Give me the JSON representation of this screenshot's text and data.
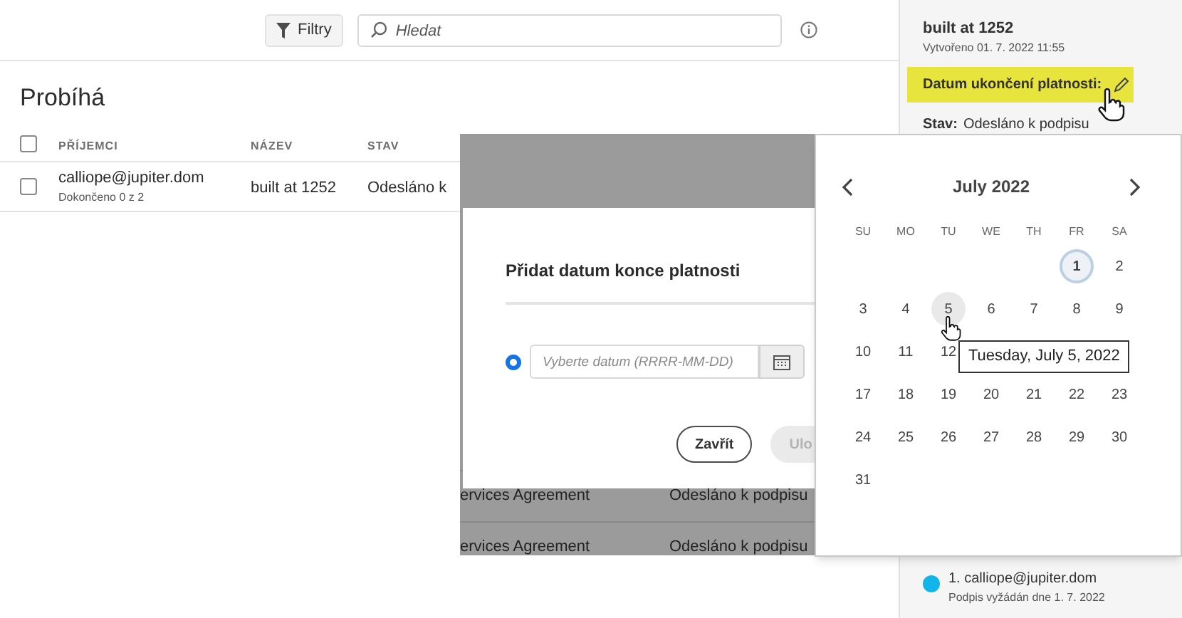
{
  "toolbar": {
    "filter_button": "Filtry",
    "search": {
      "placeholder": "Hledat"
    }
  },
  "section_title": "Probíhá",
  "table": {
    "header_checked": false,
    "columns": [
      "PŘÍJEMCI",
      "NÁZEV",
      "STAV"
    ],
    "rows": [
      {
        "checked": false,
        "recipient": "calliope@jupiter.dom",
        "progress": "Dokončeno 0 z 2",
        "name": "built at 1252",
        "status": "Odesláno k"
      }
    ]
  },
  "background_rows": [
    {
      "name": "ervices Agreement",
      "status": "Odesláno k podpisu"
    },
    {
      "name": "ervices Agreement",
      "status": "Odesláno k podpisu"
    }
  ],
  "details": {
    "title": "built at 1252",
    "created": "Vytvořeno 01. 7. 2022 11:55",
    "expiry_label": "Datum ukončení platnosti:",
    "status_label": "Stav:",
    "status": "Odesláno k podpisu",
    "signers": [
      {
        "label": "1. calliope@jupiter.dom",
        "note": "Podpis vyžádán dne 1. 7. 2022",
        "color": "#12b5ea"
      }
    ]
  },
  "dialog": {
    "title": "Přidat datum konce platnosti",
    "radio": {
      "selected": true
    },
    "date_field": {
      "placeholder": "Vyberte datum (RRRR-MM-DD)"
    },
    "buttons": [
      {
        "label": "Zavřít",
        "disabled": false
      },
      {
        "label": "Ulo",
        "disabled": true
      }
    ]
  },
  "calendar": {
    "month": "July 2022",
    "weekdays": [
      "SU",
      "MO",
      "TU",
      "WE",
      "TH",
      "FR",
      "SA"
    ],
    "weeks": [
      [
        {
          "kind": "blank"
        },
        {
          "kind": "blank"
        },
        {
          "kind": "blank"
        },
        {
          "kind": "blank"
        },
        {
          "kind": "blank"
        },
        {
          "kind": "day",
          "day": "1",
          "today": true,
          "hovered": false
        },
        {
          "kind": "day",
          "day": "2",
          "today": false,
          "hovered": false
        }
      ],
      [
        {
          "kind": "day",
          "day": "3",
          "today": false,
          "hovered": false
        },
        {
          "kind": "day",
          "day": "4",
          "today": false,
          "hovered": false
        },
        {
          "kind": "day",
          "day": "5",
          "today": false,
          "hovered": true
        },
        {
          "kind": "day",
          "day": "6",
          "today": false,
          "hovered": false
        },
        {
          "kind": "day",
          "day": "7",
          "today": false,
          "hovered": false
        },
        {
          "kind": "day",
          "day": "8",
          "today": false,
          "hovered": false
        },
        {
          "kind": "day",
          "day": "9",
          "today": false,
          "hovered": false
        }
      ],
      [
        {
          "kind": "day",
          "day": "10",
          "today": false,
          "hovered": false
        },
        {
          "kind": "day",
          "day": "11",
          "today": false,
          "hovered": false
        },
        {
          "kind": "day",
          "day": "12",
          "today": false,
          "hovered": false
        },
        {
          "kind": "blank"
        },
        {
          "kind": "blank"
        },
        {
          "kind": "blank"
        },
        {
          "kind": "blank"
        }
      ],
      [
        {
          "kind": "day",
          "day": "17",
          "today": false,
          "hovered": false
        },
        {
          "kind": "day",
          "day": "18",
          "today": false,
          "hovered": false
        },
        {
          "kind": "day",
          "day": "19",
          "today": false,
          "hovered": false
        },
        {
          "kind": "day",
          "day": "20",
          "today": false,
          "hovered": false
        },
        {
          "kind": "day",
          "day": "21",
          "today": false,
          "hovered": false
        },
        {
          "kind": "day",
          "day": "22",
          "today": false,
          "hovered": false
        },
        {
          "kind": "day",
          "day": "23",
          "today": false,
          "hovered": false
        }
      ],
      [
        {
          "kind": "day",
          "day": "24",
          "today": false,
          "hovered": false
        },
        {
          "kind": "day",
          "day": "25",
          "today": false,
          "hovered": false
        },
        {
          "kind": "day",
          "day": "26",
          "today": false,
          "hovered": false
        },
        {
          "kind": "day",
          "day": "27",
          "today": false,
          "hovered": false
        },
        {
          "kind": "day",
          "day": "28",
          "today": false,
          "hovered": false
        },
        {
          "kind": "day",
          "day": "29",
          "today": false,
          "hovered": false
        },
        {
          "kind": "day",
          "day": "30",
          "today": false,
          "hovered": false
        }
      ],
      [
        {
          "kind": "day",
          "day": "31",
          "today": false,
          "hovered": false
        },
        {
          "kind": "blank"
        },
        {
          "kind": "blank"
        },
        {
          "kind": "blank"
        },
        {
          "kind": "blank"
        },
        {
          "kind": "blank"
        },
        {
          "kind": "blank"
        }
      ]
    ],
    "tooltip": "Tuesday, July 5, 2022"
  }
}
